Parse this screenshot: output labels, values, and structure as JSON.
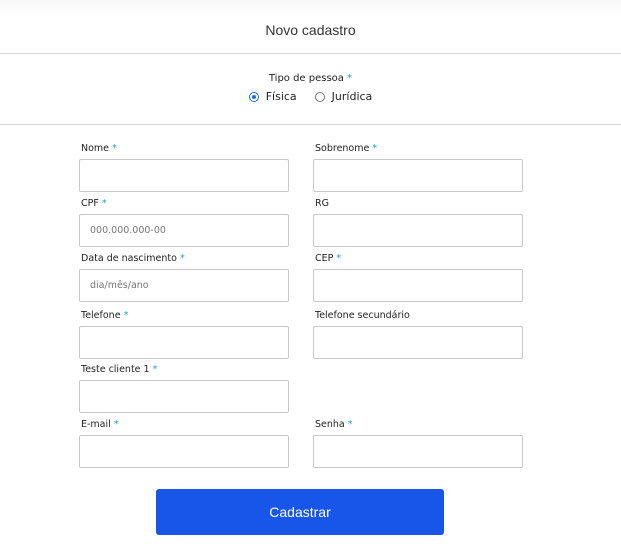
{
  "header": {
    "title": "Novo cadastro"
  },
  "person_type": {
    "label": "Tipo de pessoa",
    "required_mark": "*",
    "options": [
      {
        "label": "Física",
        "checked": true
      },
      {
        "label": "Jurídica",
        "checked": false
      }
    ]
  },
  "form": {
    "nome": {
      "label": "Nome",
      "required_mark": "*",
      "value": "",
      "placeholder": ""
    },
    "sobrenome": {
      "label": "Sobrenome",
      "required_mark": "*",
      "value": "",
      "placeholder": ""
    },
    "cpf": {
      "label": "CPF",
      "required_mark": "*",
      "value": "",
      "placeholder": "000.000.000-00"
    },
    "rg": {
      "label": "RG",
      "required_mark": "",
      "value": "",
      "placeholder": ""
    },
    "nascimento": {
      "label": "Data de nascimento",
      "required_mark": "*",
      "value": "",
      "placeholder": "dia/mês/ano"
    },
    "cep": {
      "label": "CEP",
      "required_mark": "*",
      "value": "",
      "placeholder": ""
    },
    "telefone": {
      "label": "Telefone",
      "required_mark": "*",
      "value": "",
      "placeholder": ""
    },
    "telefone_secundario": {
      "label": "Telefone secundário",
      "required_mark": "",
      "value": "",
      "placeholder": ""
    },
    "teste_cliente": {
      "label": "Teste cliente 1",
      "required_mark": "*",
      "value": "",
      "placeholder": ""
    },
    "email": {
      "label": "E-mail",
      "required_mark": "*",
      "value": "",
      "placeholder": ""
    },
    "senha": {
      "label": "Senha",
      "required_mark": "*",
      "value": "",
      "placeholder": ""
    }
  },
  "submit": {
    "label": "Cadastrar"
  },
  "colors": {
    "accent": "#1756e8",
    "required": "#1aa3c8",
    "radio_checked": "#1e6fd9"
  }
}
